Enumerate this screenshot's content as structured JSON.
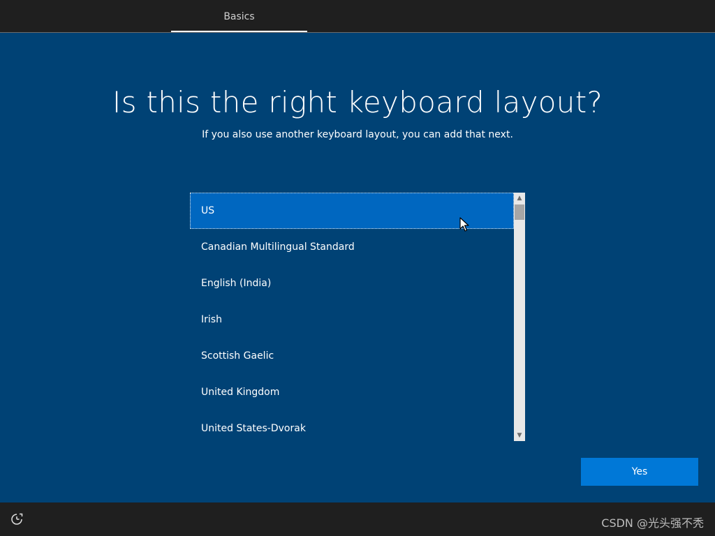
{
  "header": {
    "tab_label": "Basics"
  },
  "main": {
    "title": "Is this the right keyboard layout?",
    "subtitle": "If you also use another keyboard layout, you can add that next."
  },
  "keyboard_list": {
    "selected_index": 0,
    "items": [
      {
        "label": "US"
      },
      {
        "label": "Canadian Multilingual Standard"
      },
      {
        "label": "English (India)"
      },
      {
        "label": "Irish"
      },
      {
        "label": "Scottish Gaelic"
      },
      {
        "label": "United Kingdom"
      },
      {
        "label": "United States-Dvorak"
      }
    ]
  },
  "actions": {
    "yes_label": "Yes"
  },
  "footer": {
    "ease_of_access_icon": "ease-of-access-icon",
    "watermark": "CSDN @光头强不秃"
  },
  "colors": {
    "background": "#004275",
    "selected_item": "#0067c0",
    "button": "#0078d7",
    "bar": "#1f1f1f"
  }
}
